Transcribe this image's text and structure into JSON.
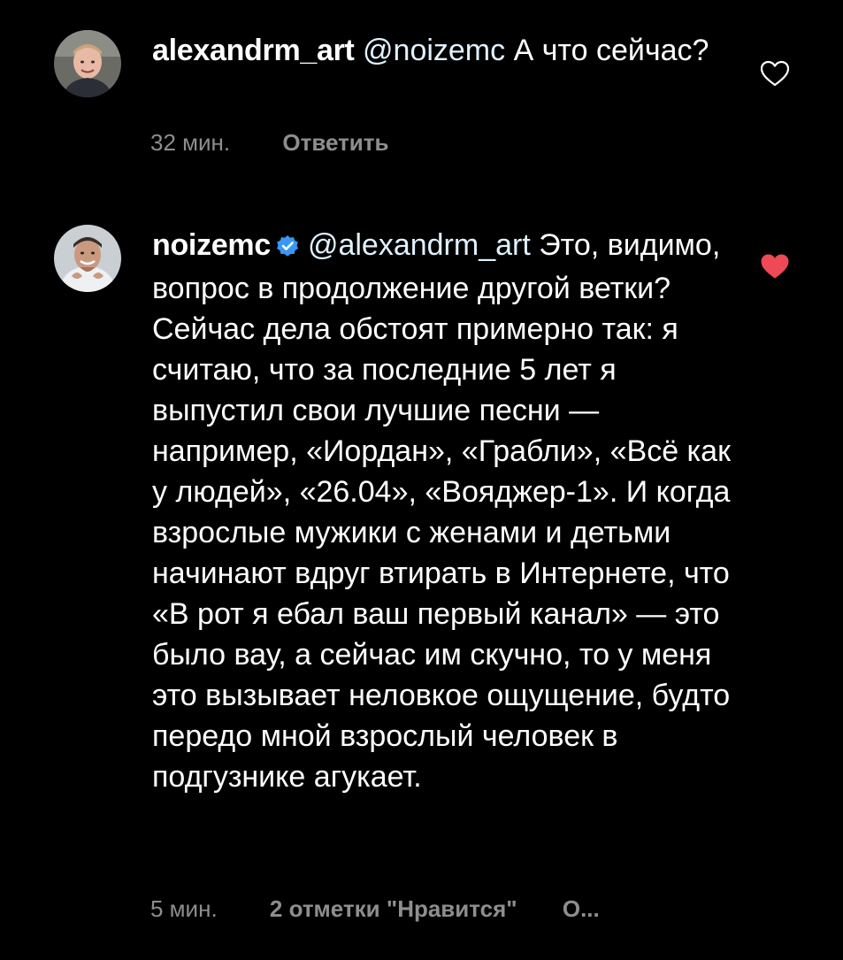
{
  "comments": [
    {
      "username": "alexandrm_art",
      "mention": "@noizemc",
      "text": " А что сейчас?",
      "time": "32 мин.",
      "reply_label": "Ответить",
      "liked": false
    },
    {
      "username": "noizemc",
      "verified": true,
      "mention": "@alexandrm_art",
      "text": " Это, видимо, вопрос в продолжение другой ветки? Сейчас дела обстоят примерно так: я считаю, что за последние 5 лет я выпустил свои лучшие песни — например, «Иордан», «Грабли», «Всё как у людей», «26.04», «Вояджер-1». И когда взрослые мужики с женами и детьми начинают вдруг втирать в Интернете, что «В рот я ебал ваш первый канал» — это было вау, а сейчас им скучно, то у меня это вызывает неловкое ощущение, будто передо мной взрослый человек в подгузнике агукает.",
      "time": "5 мин.",
      "likes_label": "2 отметки \"Нравится\"",
      "more_label": "О...",
      "liked": true
    }
  ],
  "colors": {
    "background": "#000000",
    "text": "#ffffff",
    "meta": "#8e8e8e",
    "heart_liked": "#ed4956",
    "verified": "#3897f0"
  },
  "icons": {
    "like_empty": "heart-outline-icon",
    "like_filled": "heart-filled-icon",
    "verified": "verified-badge-icon"
  }
}
